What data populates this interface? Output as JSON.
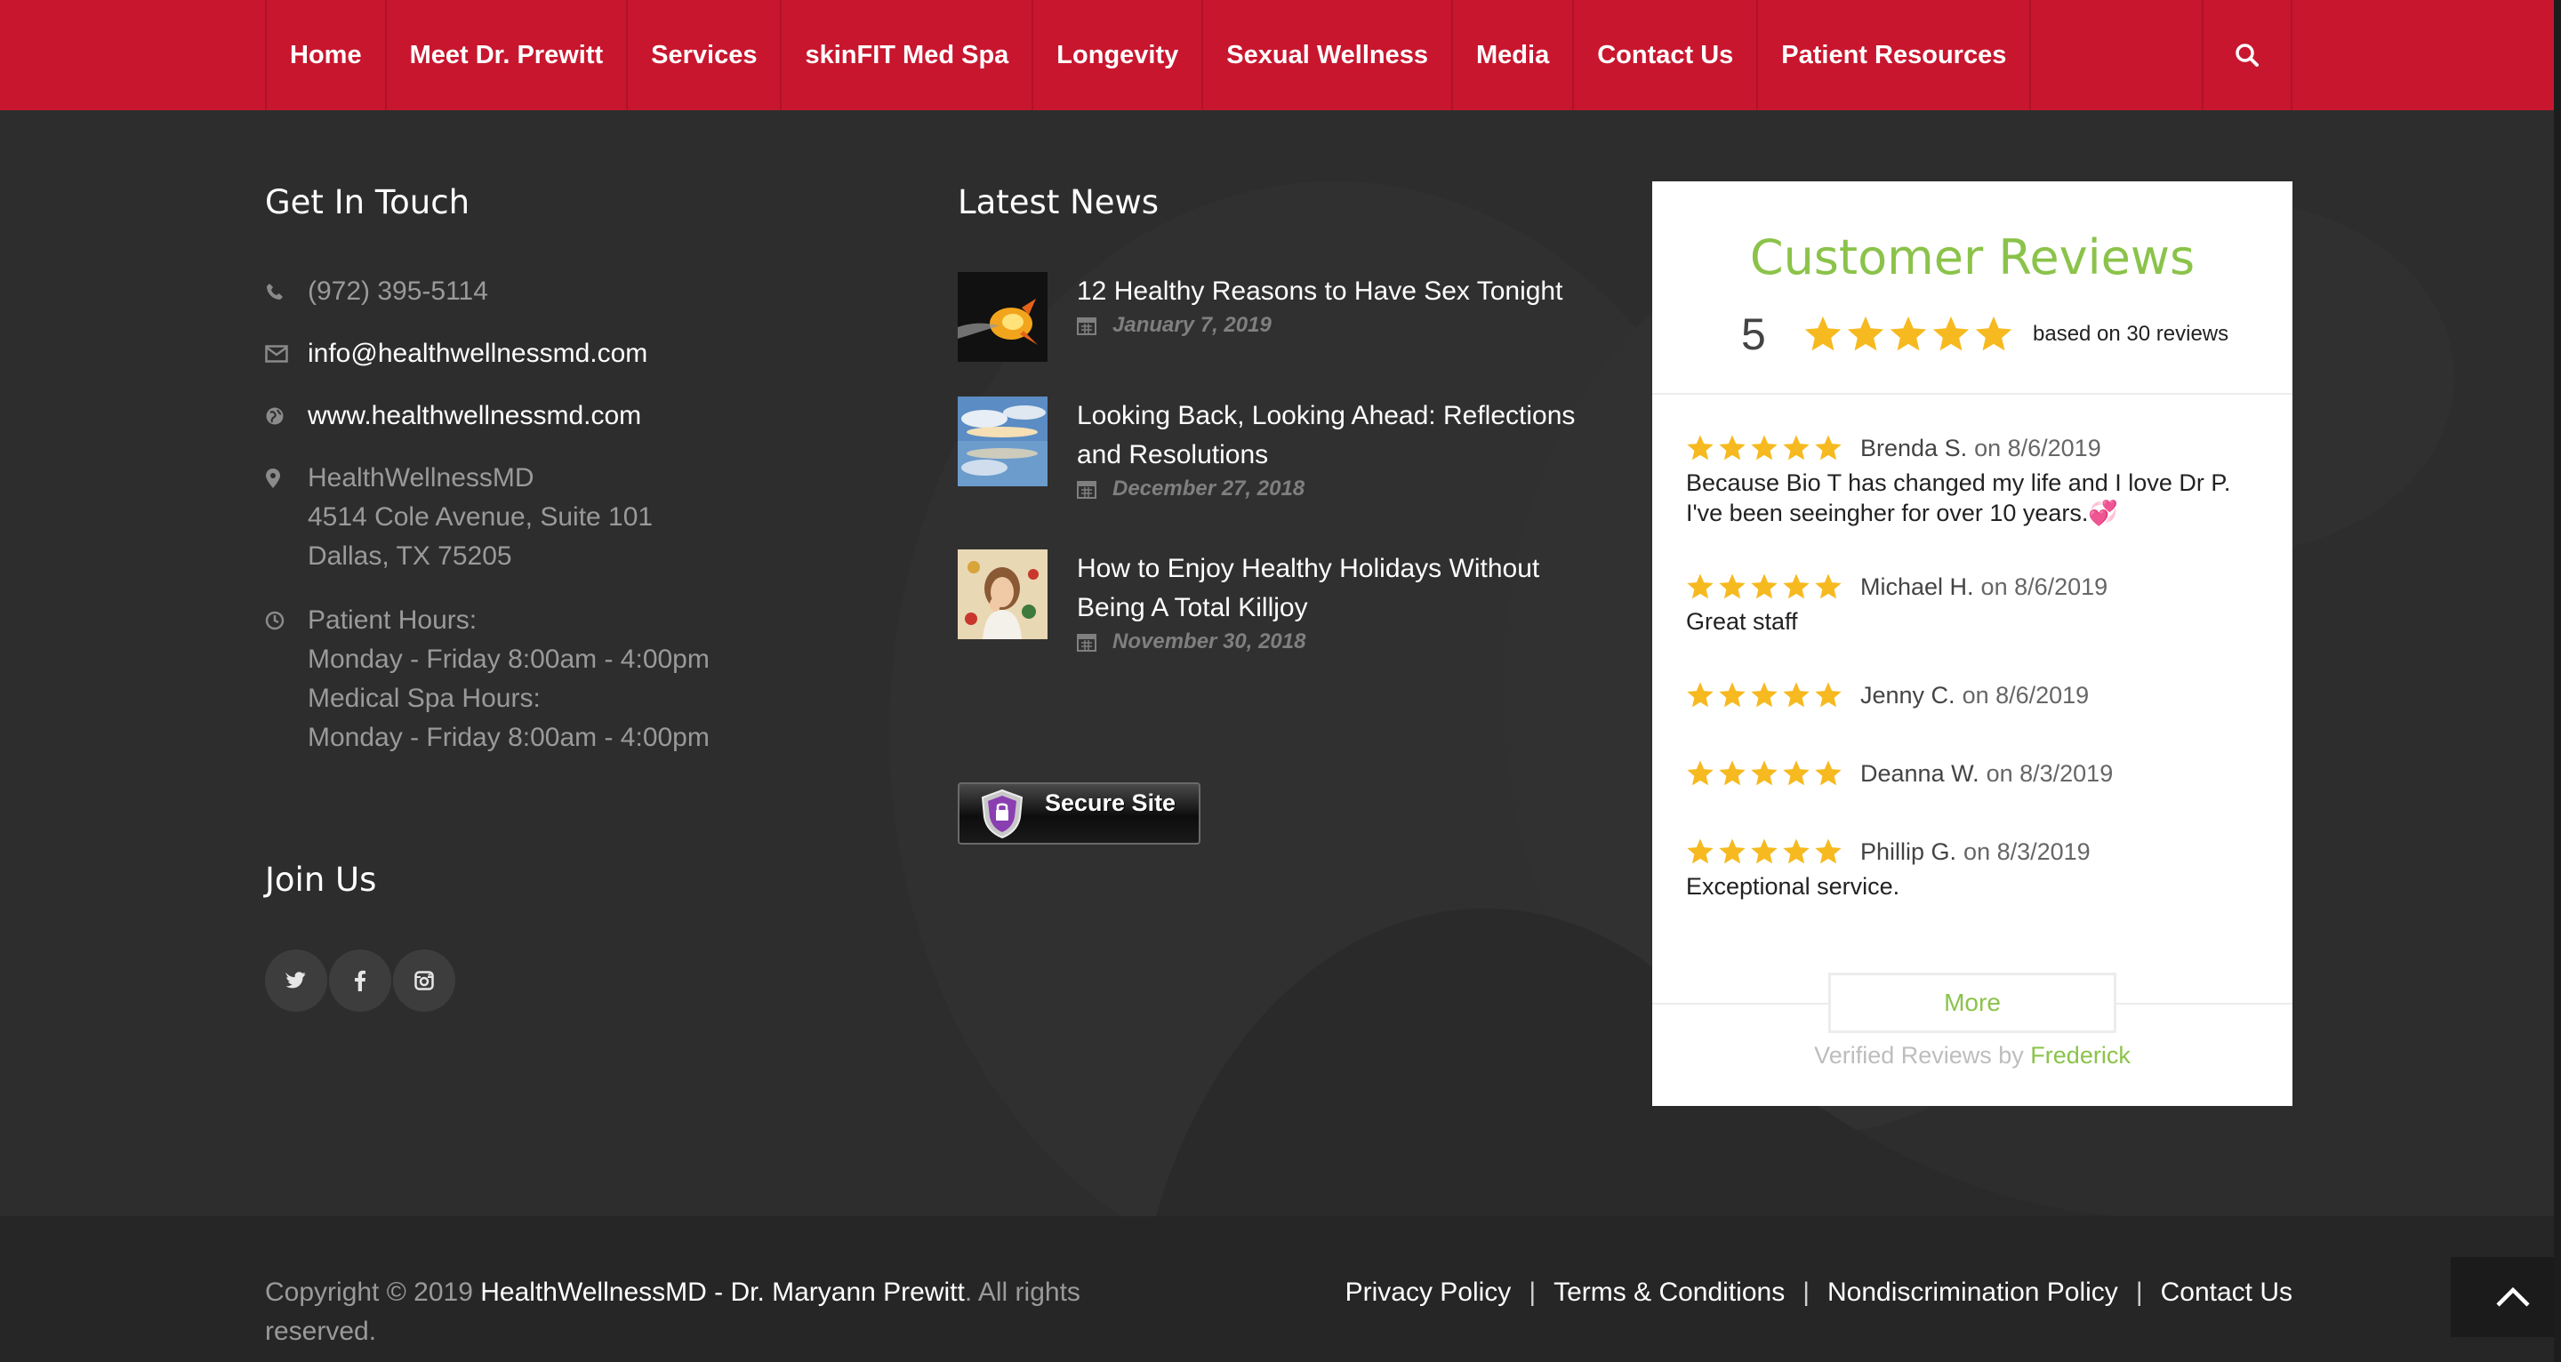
{
  "nav": {
    "items": [
      {
        "label": "Home"
      },
      {
        "label": "Meet Dr. Prewitt"
      },
      {
        "label": "Services"
      },
      {
        "label": "skinFIT Med Spa"
      },
      {
        "label": "Longevity"
      },
      {
        "label": "Sexual Wellness"
      },
      {
        "label": "Media"
      },
      {
        "label": "Contact Us"
      },
      {
        "label": "Patient Resources"
      }
    ],
    "search_icon": "search-icon"
  },
  "contact": {
    "heading": "Get In Touch",
    "phone": "(972) 395-5114",
    "email": "info@healthwellnessmd.com",
    "website": "www.healthwellnessmd.com",
    "address_name": "HealthWellnessMD",
    "address_street": "4514 Cole Avenue, Suite 101",
    "address_city": "Dallas, TX 75205",
    "patient_hours_label": "Patient Hours:",
    "patient_hours": "Monday - Friday 8:00am - 4:00pm",
    "spa_hours_label": "Medical Spa Hours:",
    "spa_hours": "Monday - Friday 8:00am - 4:00pm"
  },
  "social": {
    "heading": "Join Us",
    "icons": [
      "twitter-icon",
      "facebook-icon",
      "instagram-icon"
    ]
  },
  "news": {
    "heading": "Latest News",
    "items": [
      {
        "title": "12 Healthy Reasons to Have Sex Tonight",
        "date": "January 7, 2019"
      },
      {
        "title": "Looking Back, Looking Ahead: Reflections and Resolutions",
        "date": "December 27, 2018"
      },
      {
        "title": "How to Enjoy Healthy Holidays Without Being A Total Killjoy",
        "date": "November 30, 2018"
      }
    ],
    "badge": "Secure Site"
  },
  "reviews": {
    "title": "Customer Reviews",
    "score": "5",
    "rating": 5,
    "based_on": "based on 30 reviews",
    "items": [
      {
        "name": "Brenda S.",
        "on": "on 8/6/2019",
        "text": "Because Bio T has changed my life and I love Dr P. I've been seeingher for over 10 years.💞",
        "stars": 5
      },
      {
        "name": "Michael H.",
        "on": "on 8/6/2019",
        "text": "Great staff",
        "stars": 5
      },
      {
        "name": "Jenny C.",
        "on": "on 8/6/2019",
        "text": "",
        "stars": 5
      },
      {
        "name": "Deanna W.",
        "on": "on 8/3/2019",
        "text": "",
        "stars": 5
      },
      {
        "name": "Phillip G.",
        "on": "on 8/3/2019",
        "text": "Exceptional service.",
        "stars": 5
      }
    ],
    "more_label": "More",
    "verified_prefix": "Verified Reviews by",
    "verified_brand": "Frederick",
    "star_color": "#f6b91f",
    "accent_color": "#8bc34a"
  },
  "footer": {
    "copyright_prefix": "Copyright © 2019",
    "copyright_name": "HealthWellnessMD - Dr. Maryann Prewitt",
    "copyright_suffix": ". All rights reserved.",
    "links": [
      "Privacy Policy",
      "Terms & Conditions",
      "Nondiscrimination Policy",
      "Contact Us"
    ],
    "separator": "|"
  },
  "colors": {
    "nav_bg": "#c8162e",
    "page_bg": "#2d2d2d",
    "footer_bg": "#262626"
  }
}
